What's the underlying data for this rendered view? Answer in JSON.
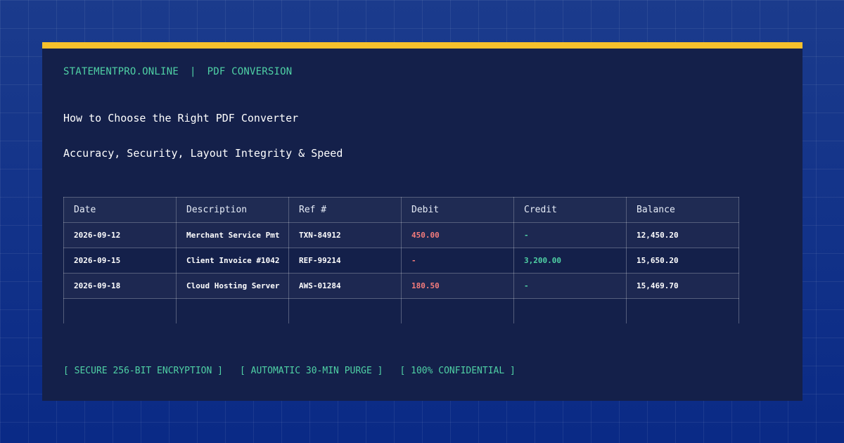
{
  "brand": {
    "site": "STATEMENTPRO.ONLINE",
    "separator": "|",
    "section": "PDF CONVERSION"
  },
  "title": "How to Choose the Right PDF Converter",
  "subtitle": "Accuracy, Security, Layout Integrity & Speed",
  "table": {
    "headers": [
      "Date",
      "Description",
      "Ref #",
      "Debit",
      "Credit",
      "Balance"
    ],
    "rows": [
      {
        "date": "2026-09-12",
        "description": "Merchant Service Pmt",
        "ref": "TXN-84912",
        "debit": "450.00",
        "credit": "-",
        "balance": "12,450.20"
      },
      {
        "date": "2026-09-15",
        "description": "Client Invoice #1042",
        "ref": "REF-99214",
        "debit": "-",
        "credit": "3,200.00",
        "balance": "15,650.20"
      },
      {
        "date": "2026-09-18",
        "description": "Cloud Hosting Server",
        "ref": "AWS-01284",
        "debit": "180.50",
        "credit": "-",
        "balance": "15,469.70"
      }
    ]
  },
  "badges": [
    "[ SECURE 256-BIT ENCRYPTION ]",
    "[ AUTOMATIC 30-MIN PURGE ]",
    "[ 100% CONFIDENTIAL ]"
  ],
  "colors": {
    "accent": "#f6c02c",
    "brand_green": "#4fd1a5",
    "debit_red": "#f47c7c",
    "card_bg": "#14204a",
    "page_bg": "#0b2a86"
  }
}
